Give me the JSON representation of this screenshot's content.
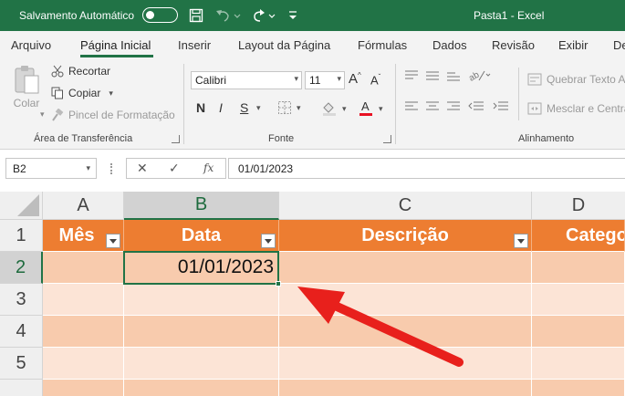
{
  "titlebar": {
    "autosave_label": "Salvamento Automático",
    "doc_title": "Pasta1  -  Excel",
    "bg_color": "#217346"
  },
  "tabs": [
    {
      "label": "Arquivo"
    },
    {
      "label": "Página Inicial",
      "active": true
    },
    {
      "label": "Inserir"
    },
    {
      "label": "Layout da Página"
    },
    {
      "label": "Fórmulas"
    },
    {
      "label": "Dados"
    },
    {
      "label": "Revisão"
    },
    {
      "label": "Exibir"
    },
    {
      "label": "De"
    }
  ],
  "ribbon": {
    "clipboard": {
      "paste_label": "Colar",
      "cut_label": "Recortar",
      "copy_label": "Copiar",
      "format_painter_label": "Pincel de Formatação",
      "group_label": "Área de Transferência"
    },
    "font": {
      "font_name": "Calibri",
      "font_size": "11",
      "bold": "N",
      "italic": "I",
      "underline": "S",
      "group_label": "Fonte",
      "font_color": "#e81123"
    },
    "alignment": {
      "wrap_label": "Quebrar Texto Au",
      "merge_label": "Mesclar e Centra",
      "group_label": "Alinhamento"
    }
  },
  "formula_bar": {
    "name_box": "B2",
    "fx": "fx",
    "formula": "01/01/2023"
  },
  "grid": {
    "columns": [
      "A",
      "B",
      "C",
      "D"
    ],
    "rows": [
      "1",
      "2",
      "3",
      "4",
      "5"
    ],
    "headers": [
      "Mês",
      "Data",
      "Descrição",
      "Catego"
    ],
    "active_cell_value": "01/01/2023",
    "header_color": "#ed7d31",
    "band_dark": "#f8cbad",
    "band_light": "#fce4d6"
  },
  "annotation": {
    "arrow_color": "#e8201c"
  }
}
